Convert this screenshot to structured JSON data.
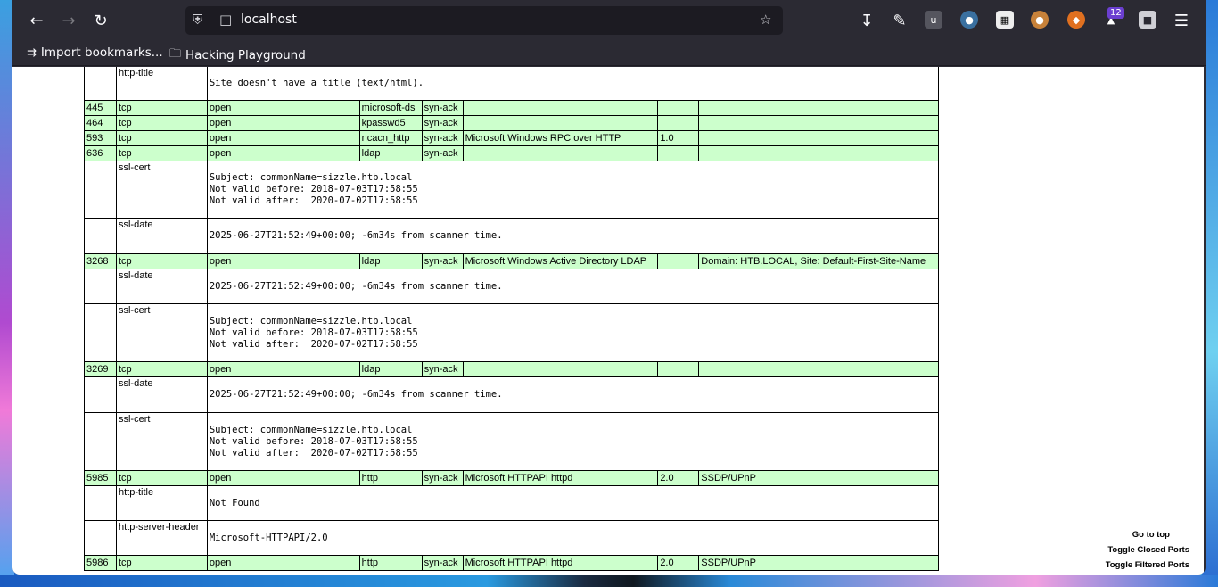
{
  "browser": {
    "url": "localhost",
    "bookmarks": [
      {
        "label": "Import bookmarks..."
      },
      {
        "label": "Hacking Playground"
      }
    ],
    "extension_badge": "12",
    "icons": [
      "back-arrow-icon",
      "forward-arrow-icon",
      "reload-icon",
      "shield-icon",
      "page-icon",
      "star-icon",
      "download-icon",
      "extensions-icon",
      "ublock-icon",
      "spy-icon",
      "qr-icon",
      "cookie-icon",
      "burp-icon",
      "extension-badge-icon",
      "container-icon",
      "menu-icon"
    ]
  },
  "rows": [
    {
      "kind": "script",
      "name": "http-title",
      "output": "Site doesn't have a title (text/html).",
      "height": 38
    },
    {
      "kind": "port",
      "port": "445",
      "proto": "tcp",
      "state": "open",
      "service": "microsoft-ds",
      "reason": "syn-ack",
      "product": "",
      "version": "",
      "extra": ""
    },
    {
      "kind": "port",
      "port": "464",
      "proto": "tcp",
      "state": "open",
      "service": "kpasswd5",
      "reason": "syn-ack",
      "product": "",
      "version": "",
      "extra": ""
    },
    {
      "kind": "port",
      "port": "593",
      "proto": "tcp",
      "state": "open",
      "service": "ncacn_http",
      "reason": "syn-ack",
      "product": "Microsoft Windows RPC over HTTP",
      "version": "1.0",
      "extra": ""
    },
    {
      "kind": "port",
      "port": "636",
      "proto": "tcp",
      "state": "open",
      "service": "ldap",
      "reason": "syn-ack",
      "product": "",
      "version": "",
      "extra": ""
    },
    {
      "kind": "script",
      "name": "ssl-cert",
      "output": "Subject: commonName=sizzle.htb.local\nNot valid before: 2018-07-03T17:58:55\nNot valid after:  2020-07-02T17:58:55",
      "height": 64
    },
    {
      "kind": "script",
      "name": "ssl-date",
      "output": "2025-06-27T21:52:49+00:00; -6m34s from scanner time.",
      "height": 40
    },
    {
      "kind": "port",
      "port": "3268",
      "proto": "tcp",
      "state": "open",
      "service": "ldap",
      "reason": "syn-ack",
      "product": "Microsoft Windows Active Directory LDAP",
      "version": "",
      "extra": "Domain: HTB.LOCAL, Site: Default-First-Site-Name"
    },
    {
      "kind": "script",
      "name": "ssl-date",
      "output": "2025-06-27T21:52:49+00:00; -6m34s from scanner time.",
      "height": 39
    },
    {
      "kind": "script",
      "name": "ssl-cert",
      "output": "Subject: commonName=sizzle.htb.local\nNot valid before: 2018-07-03T17:58:55\nNot valid after:  2020-07-02T17:58:55",
      "height": 65
    },
    {
      "kind": "port",
      "port": "3269",
      "proto": "tcp",
      "state": "open",
      "service": "ldap",
      "reason": "syn-ack",
      "product": "",
      "version": "",
      "extra": ""
    },
    {
      "kind": "script",
      "name": "ssl-date",
      "output": "2025-06-27T21:52:49+00:00; -6m34s from scanner time.",
      "height": 40
    },
    {
      "kind": "script",
      "name": "ssl-cert",
      "output": "Subject: commonName=sizzle.htb.local\nNot valid before: 2018-07-03T17:58:55\nNot valid after:  2020-07-02T17:58:55",
      "height": 65
    },
    {
      "kind": "port",
      "port": "5985",
      "proto": "tcp",
      "state": "open",
      "service": "http",
      "reason": "syn-ack",
      "product": "Microsoft HTTPAPI httpd",
      "version": "2.0",
      "extra": "SSDP/UPnP"
    },
    {
      "kind": "script",
      "name": "http-title",
      "output": "Not Found",
      "height": 39
    },
    {
      "kind": "script",
      "name": "http-server-header",
      "output": "Microsoft-HTTPAPI/2.0",
      "height": 39
    },
    {
      "kind": "port",
      "port": "5986",
      "proto": "tcp",
      "state": "open",
      "service": "http",
      "reason": "syn-ack",
      "product": "Microsoft HTTPAPI httpd",
      "version": "2.0",
      "extra": "SSDP/UPnP"
    }
  ],
  "side_links": {
    "go_to_top": "Go to top",
    "toggle_closed": "Toggle Closed Ports",
    "toggle_filtered": "Toggle Filtered Ports"
  }
}
